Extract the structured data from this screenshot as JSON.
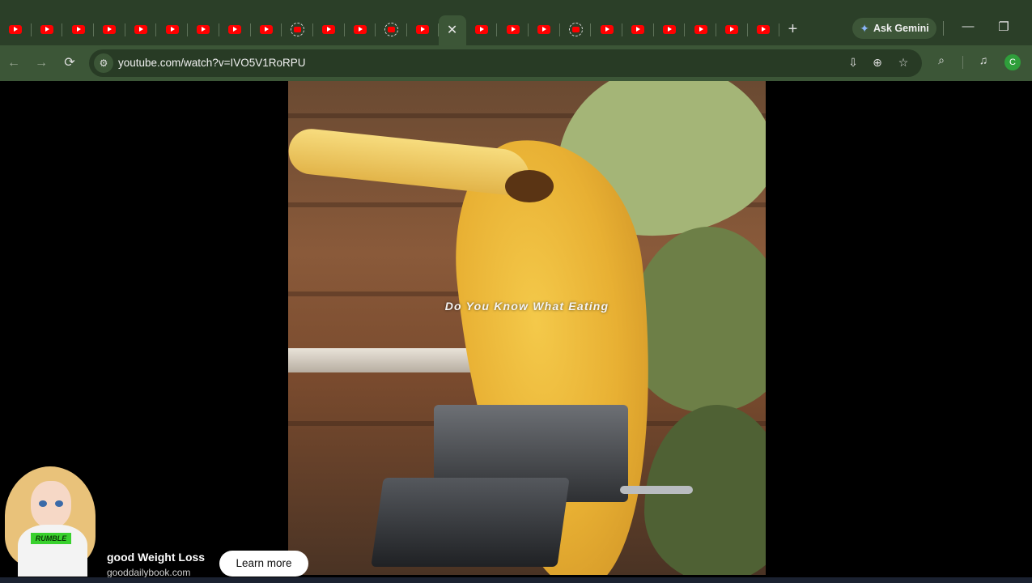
{
  "browser": {
    "tabs_before_active": [
      "yt",
      "yt",
      "yt",
      "yt",
      "yt",
      "yt",
      "yt",
      "yt",
      "yt",
      "loading",
      "yt",
      "yt",
      "loading",
      "yt"
    ],
    "tabs_after_active": [
      "yt",
      "yt",
      "yt",
      "loading",
      "yt",
      "yt",
      "yt",
      "yt",
      "yt",
      "yt"
    ],
    "active_tab_close": "✕",
    "new_tab": "+",
    "ask_gemini": "Ask Gemini",
    "window_minimize": "—",
    "window_restore": "❐",
    "url": "youtube.com/watch?v=IVO5V1RoRPU",
    "avatar_letter": "C",
    "colors": {
      "frame": "#2b3f28",
      "toolbar": "#3c5637",
      "omnibox": "#283b25",
      "youtube_red": "#ff0000"
    }
  },
  "video": {
    "caption": "Do You Know What Eating"
  },
  "ad": {
    "title": "good Weight Loss",
    "domain": "gooddailybook.com",
    "cta": "Learn more",
    "hoodie_text": "RUMBLE"
  }
}
